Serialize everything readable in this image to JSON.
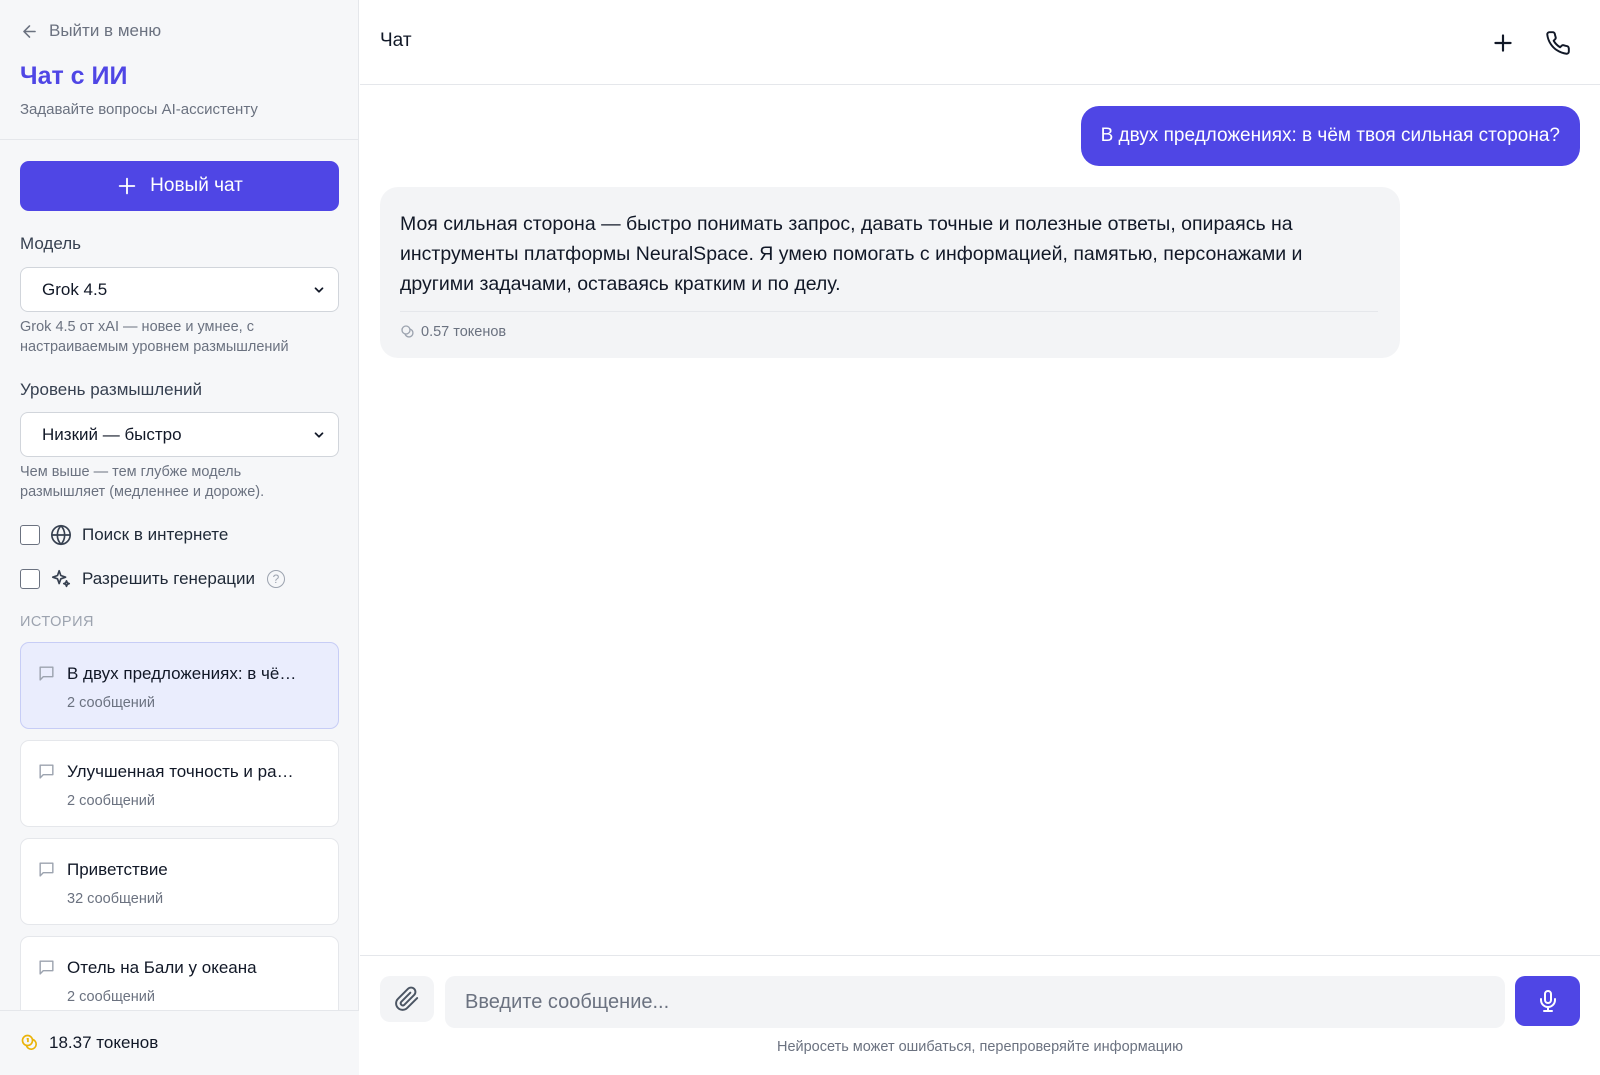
{
  "sidebar": {
    "back_label": "Выйти в меню",
    "title": "Чат с ИИ",
    "subtitle": "Задавайте вопросы AI-ассистенту",
    "new_chat_label": "Новый чат",
    "model": {
      "label": "Модель",
      "selected": "Grok 4.5",
      "hint": "Grok 4.5 от xAI — новее и умнее, с настраиваемым уровнем размышлений"
    },
    "thinking": {
      "label": "Уровень размышлений",
      "selected": "Низкий — быстро",
      "hint": "Чем выше — тем глубже модель размышляет (медленнее и дороже)."
    },
    "web_search": {
      "label": "Поиск в интернете",
      "checked": false
    },
    "allow_generations": {
      "label": "Разрешить генерации",
      "checked": false,
      "help": "?"
    },
    "history_label": "ИСТОРИЯ",
    "history": [
      {
        "title": "В двух предложениях: в чём твоя сильная сторона?",
        "count": "2 сообщений",
        "active": true
      },
      {
        "title": "Улучшенная точность и работа",
        "count": "2 сообщений",
        "active": false
      },
      {
        "title": "Приветствие",
        "count": "32 сообщений",
        "active": false
      },
      {
        "title": "Отель на Бали у океана",
        "count": "2 сообщений",
        "active": false
      }
    ],
    "balance": "18.37 токенов"
  },
  "main": {
    "title": "Чат",
    "messages": {
      "user": "В двух предложениях: в чём твоя сильная сторона?",
      "assistant": "Моя сильная сторона — быстро понимать запрос, давать точные и полезные ответы, опираясь на инструменты платформы NeuralSpace. Я умею помогать с информацией, памятью, персонажами и другими задачами, оставаясь кратким и по делу.",
      "assistant_cost": "0.57 токенов"
    },
    "composer": {
      "placeholder": "Введите сообщение...",
      "value": "",
      "disclaimer": "Нейросеть может ошибаться, перепроверяйте информацию"
    }
  },
  "colors": {
    "accent": "#4f46e5",
    "sidebar_bg": "#f6f7f9",
    "active_history_bg": "#eaedfd",
    "coin": "#eab308"
  },
  "icons": [
    "arrow-left-icon",
    "plus-icon",
    "chevron-down-icon",
    "globe-icon",
    "sparkles-icon",
    "help-icon",
    "message-icon",
    "coins-icon",
    "phone-icon",
    "paperclip-icon",
    "microphone-icon"
  ]
}
